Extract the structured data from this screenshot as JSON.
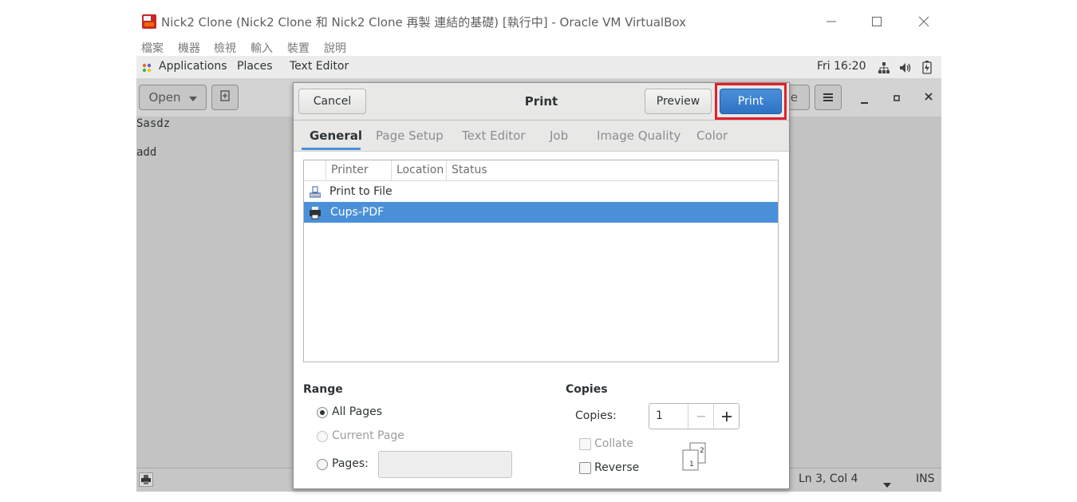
{
  "vbox": {
    "title": "Nick2 Clone (Nick2 Clone 和 Nick2 Clone 再製 連結的基礎) [執行中] - Oracle VM VirtualBox",
    "menu": [
      "檔案",
      "機器",
      "檢視",
      "輸入",
      "裝置",
      "說明"
    ]
  },
  "topbar": {
    "applications": "Applications",
    "places": "Places",
    "app_name": "Text Editor",
    "clock": "Fri 16:20"
  },
  "editor": {
    "open_label": "Open",
    "save_partial": "e",
    "lines": [
      "Sasdz",
      "",
      "add"
    ],
    "status_position": "Ln 3, Col 4",
    "status_mode": "INS"
  },
  "dialog": {
    "title": "Print",
    "cancel": "Cancel",
    "preview": "Preview",
    "print": "Print",
    "tabs": [
      "General",
      "Page Setup",
      "Text Editor",
      "Job",
      "Image Quality",
      "Color"
    ],
    "active_tab": "General",
    "columns": [
      "Printer",
      "Location",
      "Status"
    ],
    "printers": [
      {
        "name": "Print to File",
        "icon": "file-printer-icon",
        "selected": false
      },
      {
        "name": "Cups-PDF",
        "icon": "printer-icon",
        "selected": true
      }
    ],
    "range": {
      "heading": "Range",
      "all_pages": "All Pages",
      "current_page": "Current Page",
      "pages": "Pages:",
      "pages_value": "",
      "selected": "all_pages"
    },
    "copies": {
      "heading": "Copies",
      "label": "Copies:",
      "value": "1",
      "collate": "Collate",
      "reverse": "Reverse",
      "collate_checked": false,
      "reverse_checked": false
    }
  },
  "colors": {
    "accent": "#4a90d9",
    "highlight_box": "#e41e2b"
  }
}
